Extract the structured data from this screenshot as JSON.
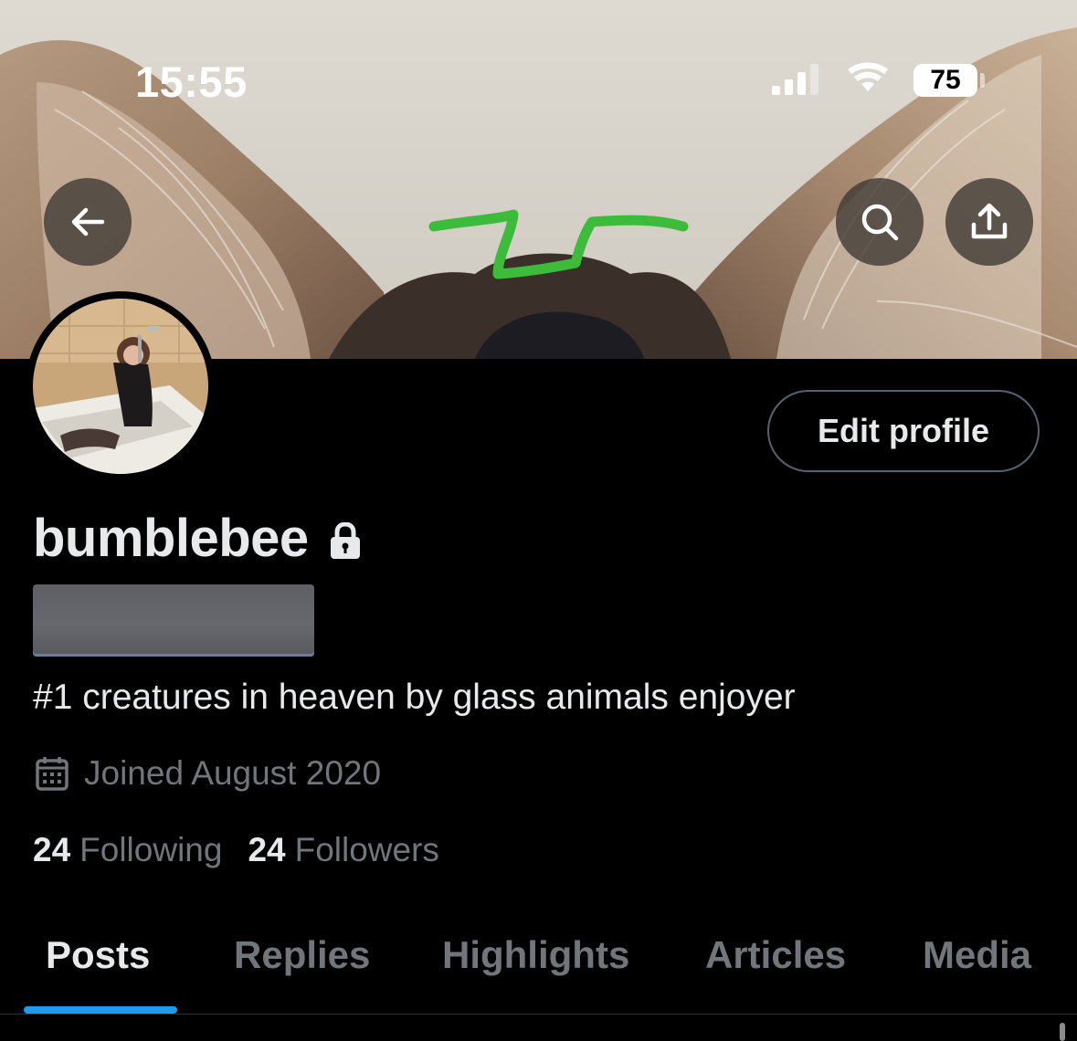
{
  "status_bar": {
    "time": "15:55",
    "battery": "75",
    "signal_icon": "cellular-signal-icon",
    "wifi_icon": "wifi-icon"
  },
  "header": {
    "back_icon": "arrow-left-icon",
    "search_icon": "search-icon",
    "share_icon": "share-upload-icon"
  },
  "profile": {
    "edit_button": "Edit profile",
    "display_name": "bumblebee",
    "protected_icon": "lock-icon",
    "bio": "#1 creatures in heaven by glass animals enjoyer",
    "joined_icon": "calendar-icon",
    "joined": "Joined August 2020",
    "following_count": "24",
    "following_label": "Following",
    "followers_count": "24",
    "followers_label": "Followers"
  },
  "tabs": [
    {
      "label": "Posts",
      "active": true
    },
    {
      "label": "Replies",
      "active": false
    },
    {
      "label": "Highlights",
      "active": false
    },
    {
      "label": "Articles",
      "active": false
    },
    {
      "label": "Media",
      "active": false
    }
  ],
  "colors": {
    "accent": "#1d9bf0",
    "background": "#000000",
    "text_primary": "#e7e9ea",
    "text_secondary": "#71767b",
    "scribble": "#3dbb3a"
  }
}
